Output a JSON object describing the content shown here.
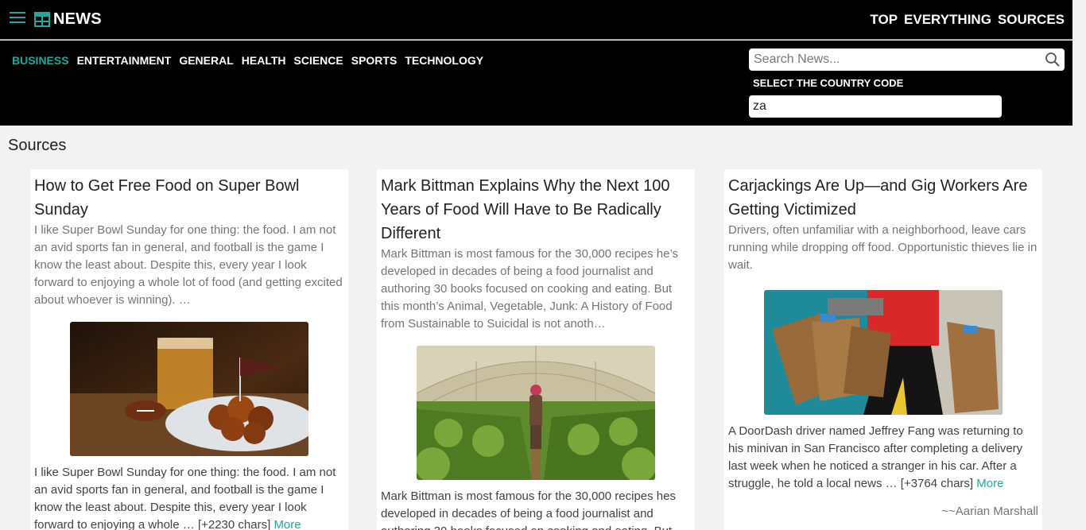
{
  "header": {
    "brand": "NEWS",
    "nav": [
      "TOP",
      "EVERYTHING",
      "SOURCES"
    ]
  },
  "categories": [
    "BUSINESS",
    "ENTERTAINMENT",
    "GENERAL",
    "HEALTH",
    "SCIENCE",
    "SPORTS",
    "TECHNOLOGY"
  ],
  "active_category": "BUSINESS",
  "search": {
    "placeholder": "Search News...",
    "value": ""
  },
  "country": {
    "label": "SELECT THE COUNTRY CODE",
    "value": "za"
  },
  "section_title": "Sources",
  "colors": {
    "accent": "#26a69a",
    "header_bg": "#000000",
    "page_bg": "#f2f2f2"
  },
  "articles": [
    {
      "title": "How to Get Free Food on Super Bowl Sunday",
      "description": "I like Super Bowl Sunday for one thing: the food. I am not an avid sports fan in general, and football is the game I know the least about. Despite this, every year I look forward to enjoying a whole lot of food (and getting excited about whoever is winning). …",
      "image": "super-bowl-wings-image",
      "content": "I like Super Bowl Sunday for one thing: the food. I am not an avid sports fan in general, and football is the game I know the least about. Despite this, every year I look forward to enjoying a whole … [+2230 chars]",
      "more": "More",
      "author": ""
    },
    {
      "title": "Mark Bittman Explains Why the Next 100 Years of Food Will Have to Be Radically Different",
      "description": "Mark Bittman is most famous for the 30,000 recipes he’s developed in decades of being a food journalist and authoring 30 books focused on cooking and eating. But this month’s Animal, Vegetable, Junk: A History of Food from Sustainable to Suicidal is not anoth…",
      "image": "greenhouse-farmer-image",
      "content": "Mark Bittman is most famous for the 30,000 recipes hes developed in decades of being a food journalist and authoring 30 books focused on cooking and eating. But",
      "more": "",
      "author": ""
    },
    {
      "title": "Carjackings Are Up—and Gig Workers Are Getting Victimized",
      "description": "Drivers, often unfamiliar with a neighborhood, leave cars running while dropping off food. Opportunistic thieves lie in wait.",
      "image": "delivery-bags-image",
      "content": "A DoorDash driver named Jeffrey Fang was returning to his minivan in San Francisco after completing a delivery last week when he noticed a stranger in his car. After a struggle, he told a local news … [+3764 chars]",
      "more": "More",
      "author": "~~Aarian Marshall"
    }
  ]
}
